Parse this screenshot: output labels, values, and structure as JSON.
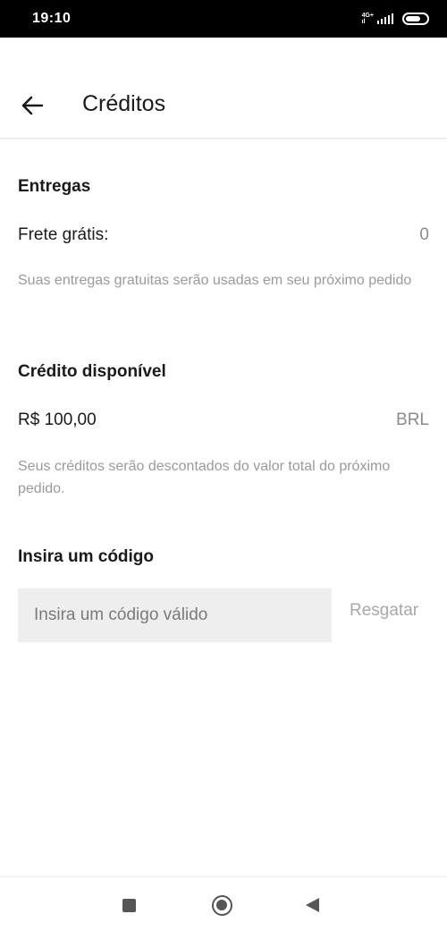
{
  "status_bar": {
    "time": "19:10",
    "network_top": "4G+",
    "network_bottom": "ıl",
    "icons": [
      "signal-icon",
      "battery-icon"
    ]
  },
  "header": {
    "back_icon": "arrow-left-icon",
    "title": "Créditos"
  },
  "deliveries": {
    "title": "Entregas",
    "free_shipping_label": "Frete grátis:",
    "free_shipping_value": "0",
    "hint": "Suas entregas gratuitas serão usadas em seu próximo pedido"
  },
  "credit": {
    "title": "Crédito disponível",
    "amount": "R$ 100,00",
    "currency": "BRL",
    "hint": "Seus créditos serão descontados do valor total do próximo pedido."
  },
  "code": {
    "title": "Insira um código",
    "value": "",
    "placeholder": "Insira um código válido",
    "redeem_label": "Resgatar"
  },
  "nav_bar": {
    "icons": [
      "recent-apps-icon",
      "home-icon",
      "back-triangle-icon"
    ]
  },
  "colors": {
    "status_bar": "#000000",
    "text_primary": "#1a1a1a",
    "text_secondary": "#9a9a9a",
    "input_background": "#eeeeee"
  }
}
